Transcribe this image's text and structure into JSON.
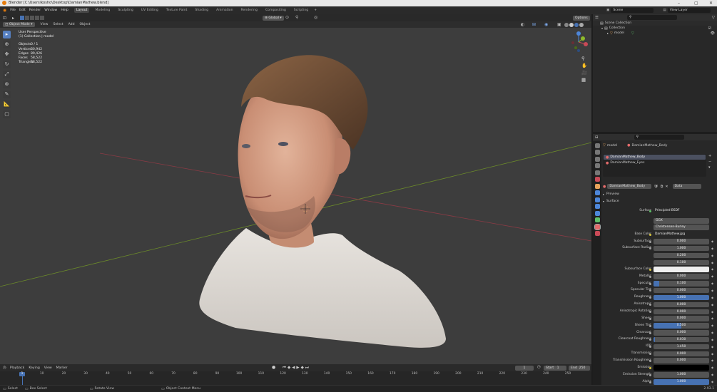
{
  "window": {
    "title": "Blender [C:\\Users\\kosho\\Desktop\\DamianMathew.blend]"
  },
  "topbar": {
    "menus": [
      "File",
      "Edit",
      "Render",
      "Window",
      "Help"
    ],
    "workspaces": [
      "Layout",
      "Modeling",
      "Sculpting",
      "UV Editing",
      "Texture Paint",
      "Shading",
      "Animation",
      "Rendering",
      "Compositing",
      "Scripting"
    ],
    "active_workspace": "Layout",
    "add_tab": "+",
    "scene_label": "Scene",
    "view_layer_label": "View Layer"
  },
  "viewport": {
    "mode": "Object Mode",
    "menus": [
      "View",
      "Select",
      "Add",
      "Object"
    ],
    "transform": "Global",
    "options": "Options",
    "overlay_title": "User Perspective",
    "overlay_collection": "(1) Collection | model",
    "stats": [
      {
        "label": "Objects",
        "value": "0 / 1"
      },
      {
        "label": "Vertices",
        "value": "30,942"
      },
      {
        "label": "Edges",
        "value": "89,426"
      },
      {
        "label": "Faces",
        "value": "58,522"
      },
      {
        "label": "Triangles",
        "value": "58,522"
      }
    ],
    "gizmo_axes": [
      "X",
      "Y",
      "Z"
    ]
  },
  "outliner": {
    "items": [
      {
        "label": "Scene Collection"
      },
      {
        "label": "Collection"
      },
      {
        "label": "model"
      }
    ]
  },
  "properties": {
    "object_name": "model",
    "material_name": "DamianMathew_Body",
    "slots": [
      "DamianMathew_Body",
      "DamianMathew_Eyes"
    ],
    "material_field": "DamianMathew_Body",
    "data_label": "Data",
    "panels": {
      "preview": "Preview",
      "surface": "Surface"
    },
    "surface": {
      "label": "Surface",
      "value": "Principled BSDF"
    },
    "dist": "GGX",
    "sss_method": "Christensen-Burley",
    "base_color": {
      "label": "Base Color",
      "value": "DamianMathew.jpg"
    },
    "fields": [
      {
        "label": "Subsurface",
        "value": "0.000",
        "fill": 0
      },
      {
        "label": "Subsurface Radius",
        "value": "1.000",
        "fill": 0
      },
      {
        "label": "",
        "value": "0.200",
        "fill": 0
      },
      {
        "label": "",
        "value": "0.100",
        "fill": 0
      },
      {
        "label": "Subsurface Color",
        "value": "",
        "fill": 0,
        "color": "#eeeeee"
      },
      {
        "label": "Metallic",
        "value": "0.000",
        "fill": 0
      },
      {
        "label": "Specular",
        "value": "0.100",
        "fill": 0.1
      },
      {
        "label": "Specular Tint",
        "value": "0.000",
        "fill": 0
      },
      {
        "label": "Roughness",
        "value": "1.000",
        "fill": 1
      },
      {
        "label": "Anisotropic",
        "value": "0.000",
        "fill": 0
      },
      {
        "label": "Anisotropic Rotation",
        "value": "0.000",
        "fill": 0
      },
      {
        "label": "Sheen",
        "value": "0.000",
        "fill": 0
      },
      {
        "label": "Sheen Tint",
        "value": "0.500",
        "fill": 0.5
      },
      {
        "label": "Clearcoat",
        "value": "0.000",
        "fill": 0
      },
      {
        "label": "Clearcoat Roughness",
        "value": "0.030",
        "fill": 0.03
      },
      {
        "label": "IOR",
        "value": "1.450",
        "fill": 0
      },
      {
        "label": "Transmission",
        "value": "0.000",
        "fill": 0
      },
      {
        "label": "Transmission Roughness",
        "value": "0.000",
        "fill": 0
      },
      {
        "label": "Emission",
        "value": "",
        "fill": 0,
        "color": "#000000"
      },
      {
        "label": "Emission Strength",
        "value": "1.000",
        "fill": 0
      },
      {
        "label": "Alpha",
        "value": "1.000",
        "fill": 1
      }
    ]
  },
  "timeline": {
    "menus": [
      "Playback",
      "Keying",
      "View",
      "Marker"
    ],
    "current_frame": "1",
    "start_label": "Start",
    "start_value": "1",
    "end_label": "End",
    "end_value": "250",
    "ruler": [
      "1",
      "10",
      "20",
      "30",
      "40",
      "50",
      "60",
      "70",
      "80",
      "90",
      "100",
      "110",
      "120",
      "130",
      "140",
      "150",
      "160",
      "170",
      "180",
      "190",
      "200",
      "210",
      "220",
      "230",
      "240",
      "250"
    ]
  },
  "statusbar": {
    "items": [
      "Select",
      "Box Select",
      "Rotate View",
      "Object Context Menu"
    ],
    "version": "2.93.1"
  },
  "colors": {
    "accent": "#4772b3",
    "axis_x": "#c94a57",
    "axis_y": "#8dba2b",
    "axis_z": "#4d86d9"
  }
}
